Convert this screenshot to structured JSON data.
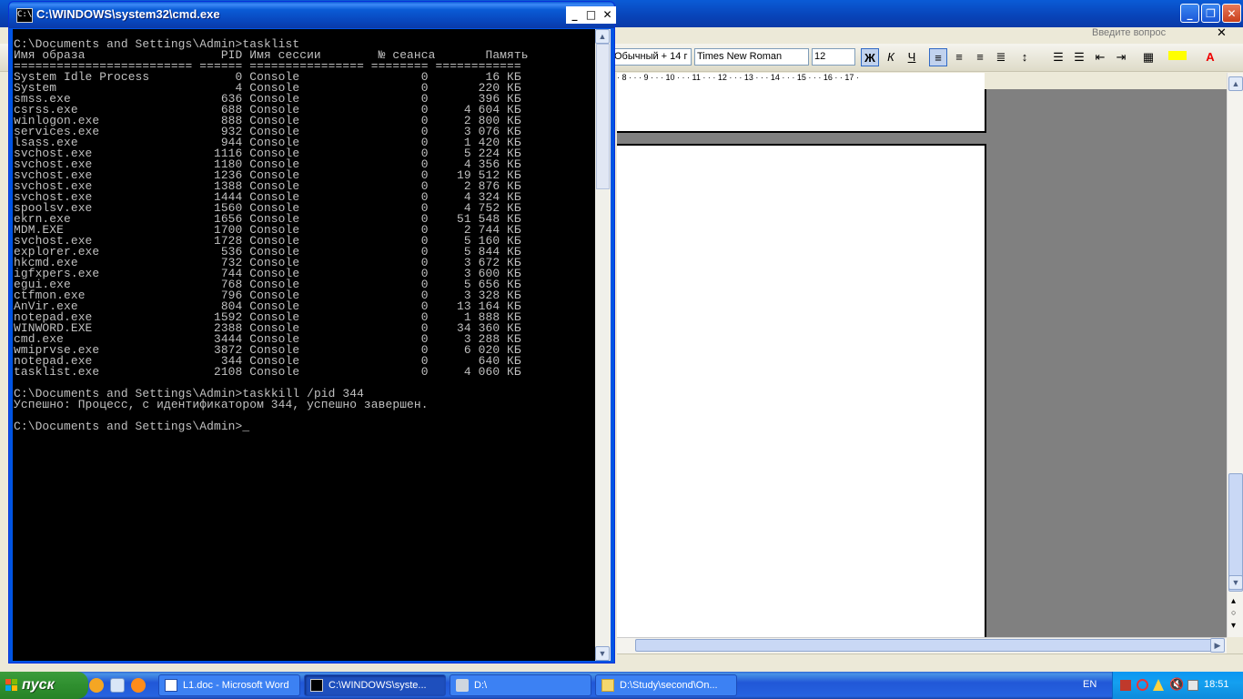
{
  "word": {
    "title_buttons": [
      "_",
      "❐",
      "✕"
    ],
    "help_placeholder": "Введите вопрос",
    "style_box": "Обычный + 14 г",
    "font_box": "Times New Roman",
    "size_box": "12",
    "bold": "Ж",
    "italic": "К",
    "underline": "Ч",
    "ruler": "· 8 · · · 9 · · · 10 · · · 11 · · · 12 · · · 13 · · · 14 · · · 15 · · · 16 · · 17 ·"
  },
  "cmd": {
    "title": "C:\\WINDOWS\\system32\\cmd.exe",
    "icon_label": "C:\\",
    "buttons": [
      "_",
      "□",
      "✕"
    ],
    "prompt": "C:\\Documents and Settings\\Admin>",
    "command1": "tasklist",
    "header": "Имя образа                   PID Имя сессии        № сеанса       Память",
    "separator": "========================= ====== ================ ======== ============",
    "processes": [
      "System Idle Process            0 Console                 0        16 КБ",
      "System                         4 Console                 0       220 КБ",
      "smss.exe                     636 Console                 0       396 КБ",
      "csrss.exe                    688 Console                 0     4 604 КБ",
      "winlogon.exe                 888 Console                 0     2 800 КБ",
      "services.exe                 932 Console                 0     3 076 КБ",
      "lsass.exe                    944 Console                 0     1 420 КБ",
      "svchost.exe                 1116 Console                 0     5 224 КБ",
      "svchost.exe                 1180 Console                 0     4 356 КБ",
      "svchost.exe                 1236 Console                 0    19 512 КБ",
      "svchost.exe                 1388 Console                 0     2 876 КБ",
      "svchost.exe                 1444 Console                 0     4 324 КБ",
      "spoolsv.exe                 1560 Console                 0     4 752 КБ",
      "ekrn.exe                    1656 Console                 0    51 548 КБ",
      "MDM.EXE                     1700 Console                 0     2 744 КБ",
      "svchost.exe                 1728 Console                 0     5 160 КБ",
      "explorer.exe                 536 Console                 0     5 844 КБ",
      "hkcmd.exe                    732 Console                 0     3 672 КБ",
      "igfxpers.exe                 744 Console                 0     3 600 КБ",
      "egui.exe                     768 Console                 0     5 656 КБ",
      "ctfmon.exe                   796 Console                 0     3 328 КБ",
      "AnVir.exe                    804 Console                 0    13 164 КБ",
      "notepad.exe                 1592 Console                 0     1 888 КБ",
      "WINWORD.EXE                 2388 Console                 0    34 360 КБ",
      "cmd.exe                     3444 Console                 0     3 288 КБ",
      "wmiprvse.exe                3872 Console                 0     6 020 КБ",
      "notepad.exe                  344 Console                 0       640 КБ",
      "tasklist.exe                2108 Console                 0     4 060 КБ"
    ],
    "command2": "taskkill /pid 344",
    "result": "Успешно: Процесс, с идентификатором 344, успешно завершен."
  },
  "taskbar": {
    "start_label": "пуск",
    "tasks": [
      {
        "label": "L1.doc - Microsoft Word"
      },
      {
        "label": "C:\\WINDOWS\\syste..."
      },
      {
        "label": "D:\\"
      },
      {
        "label": "D:\\Study\\second\\On..."
      }
    ],
    "language": "EN",
    "clock": "18:51"
  }
}
